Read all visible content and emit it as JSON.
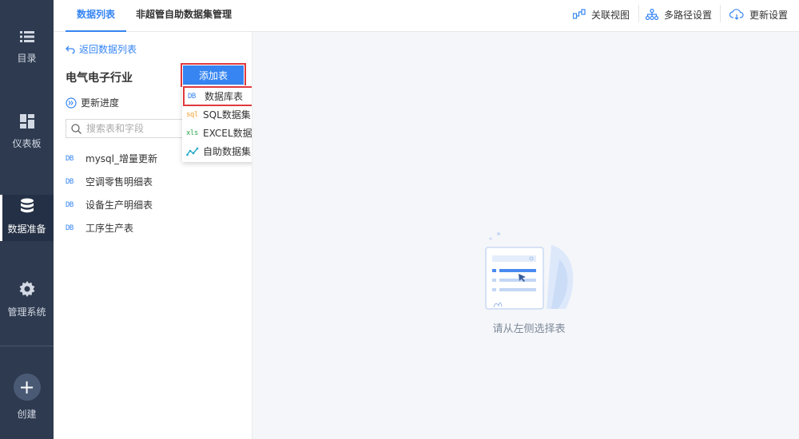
{
  "nav": {
    "catalog": "目录",
    "dashboard": "仪表板",
    "data_prep": "数据准备",
    "admin": "管理系统",
    "create": "创建"
  },
  "tabs": {
    "data_list": "数据列表",
    "self_service_mgmt": "非超管自助数据集管理"
  },
  "toolbar": {
    "relation_view": "关联视图",
    "multipath": "多路径设置",
    "update_settings": "更新设置"
  },
  "panel": {
    "back_link": "返回数据列表",
    "package_title": "电气电子行业",
    "update_progress": "更新进度",
    "search_placeholder": "搜索表和字段",
    "tables": [
      {
        "tag": "DB",
        "name": "mysql_增量更新"
      },
      {
        "tag": "DB",
        "name": "空调零售明细表"
      },
      {
        "tag": "DB",
        "name": "设备生产明细表"
      },
      {
        "tag": "DB",
        "name": "工序生产表"
      }
    ]
  },
  "add_table": {
    "button_label": "添加表",
    "menu": [
      {
        "tag": "DB",
        "label": "数据库表"
      },
      {
        "tag": "sql",
        "label": "SQL数据集"
      },
      {
        "tag": "xls",
        "label": "EXCEL数据集"
      },
      {
        "tag": "",
        "label": "自助数据集"
      }
    ]
  },
  "main": {
    "empty_text": "请从左侧选择表"
  },
  "colors": {
    "accent": "#3685f2",
    "nav_bg": "#2e3a4f",
    "highlight_border": "#e0393e"
  }
}
